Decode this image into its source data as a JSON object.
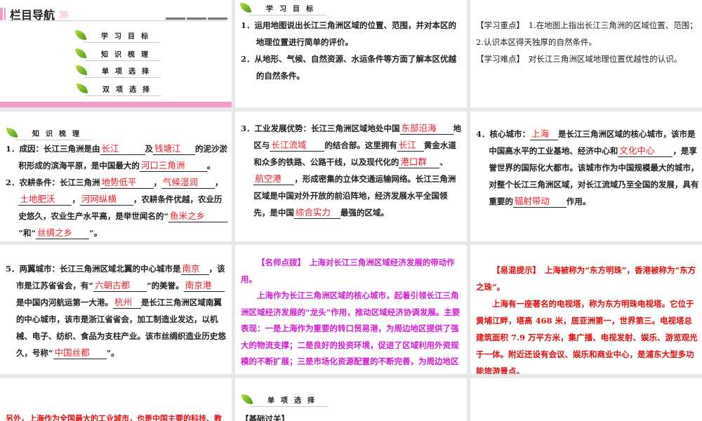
{
  "nav": {
    "title": "栏目导航",
    "arrows": "》》》",
    "items": [
      "学习目标",
      "知识梳理",
      "单项选择",
      "双项选择"
    ]
  },
  "objectives": {
    "heading": "学习目标",
    "items": [
      "1．运用地图说出长江三角洲区域的位置、范围，并对本区的地理位置进行简单的评价。",
      "2．从地形、气候、自然资源、水运条件等方面了解本区优越的自然条件。"
    ]
  },
  "key_points": {
    "focus": "【学习重点】　1.在地图上指出长江三角洲的区域位置、范围；2.认识本区得天独厚的自然条件。",
    "difficulty": "【学习难点】　对长江三角洲区域地理位置优越性的认识。"
  },
  "knowledge": {
    "heading": "知识梳理",
    "p1": [
      {
        "t": "1．成因：长江三角洲是由"
      },
      {
        "b": "长江",
        "w": 60
      },
      {
        "t": "及"
      },
      {
        "b": "钱塘江",
        "w": 56
      },
      {
        "t": "的泥沙淤积形成的滨海平原，是中国最大的"
      },
      {
        "b": "河口三角洲",
        "w": 92
      },
      {
        "t": "。"
      }
    ],
    "p2": [
      {
        "t": "2．农耕条件：长江三角洲"
      },
      {
        "b": "地势低平",
        "w": 72
      },
      {
        "t": "，"
      },
      {
        "b": "气候湿润",
        "w": 72
      },
      {
        "t": "，"
      },
      {
        "b": "土地肥沃",
        "w": 72
      },
      {
        "t": "，"
      },
      {
        "b": "河网纵横",
        "w": 72
      },
      {
        "t": "，农耕条件优越，农业历史悠久，农业生产水平高，是举世闻名的“"
      },
      {
        "b": "鱼米之乡",
        "w": 80
      },
      {
        "t": "”和“"
      },
      {
        "b": "丝绸之乡",
        "w": 72
      },
      {
        "t": "”。"
      }
    ],
    "p3": [
      {
        "t": "3．工业发展优势：长江三角洲区域地处中国"
      },
      {
        "b": "东部沿海",
        "w": 72
      },
      {
        "t": "地区与"
      },
      {
        "b": "长江流域",
        "w": 74
      },
      {
        "t": "的结合部。这里拥有"
      },
      {
        "b": "长江",
        "w": 34
      },
      {
        "t": "黄金水道和众多的铁路、公路干线，以及现代化的"
      },
      {
        "b": "港口群",
        "w": 54
      },
      {
        "t": "、"
      },
      {
        "b": "航空港",
        "w": 54
      },
      {
        "t": "，形成密集的立体交通运输网络。长江三角洲区域是中国对外开放的前沿阵地，经济发展水平全国领先，是中国"
      },
      {
        "b": "综合实力",
        "w": 62
      },
      {
        "t": "最强的区域。"
      }
    ],
    "p4": [
      {
        "t": "4．核心城市："
      },
      {
        "b": "上海",
        "w": 36
      },
      {
        "t": "是长江三角洲区域的核心城市，该市是中国高水平的工业基地、经济中心和"
      },
      {
        "b": "文化中心",
        "w": 74
      },
      {
        "t": "，是享誉世界的国际化大都市。该城市作为中国规模最大的城市，对整个长江三角洲区域，对长江流域乃至全国的发展，具有重要的"
      },
      {
        "b": "辐射带动",
        "w": 72
      },
      {
        "t": "作用。"
      }
    ],
    "p5": [
      {
        "t": "5．两翼城市：长江三角洲区域北翼的中心城市是"
      },
      {
        "b": "南京",
        "w": 36
      },
      {
        "t": "，该市是江苏省省会，有“"
      },
      {
        "b": "六朝古都",
        "w": 72
      },
      {
        "t": "”的美誉。"
      },
      {
        "b": "南京港",
        "w": 54
      },
      {
        "t": "是中国内河航运第一大港。"
      },
      {
        "b": "杭州",
        "w": 36
      },
      {
        "t": "是长江三角洲区域南翼的中心城市，该市是浙江省省会，加工制造业发达，以机械、电子、纺织、食品为支柱产业。该市丝绸织造业历史悠久，号称“"
      },
      {
        "b": "中国丝都",
        "w": 72
      },
      {
        "t": "”。"
      }
    ]
  },
  "teacher_tip": {
    "title": "【名师点拨】　上海对长江三角洲区域经济发展的带动作用。",
    "body": "上海作为长江三角洲区域的核心城市，起着引领长江三角洲区域经济发展的“龙头”作用，推动区域经济协调发展。主要表现：一是上海作为重要的转口贸易港，为周边地区提供了强大的物流支撑；二是良好的投资环境，促进了区域利用外资规模的不断扩展；三是市场化资源配置的不断完善，为周边地区经济的持续快速发展发挥了重要的带动作用。"
  },
  "confusion_tip": {
    "title": "【易混提示】　上海被称为“东方明珠”，香港被称为“东方之珠”。",
    "body": "上海有一座著名的电视塔，称为东方明珠电视塔。它位于黄埔江畔，塔高 468 米，居亚洲第一，世界第三。电视塔总建筑面积 7.9 万平方米，集广播、电视发射、娱乐、游览观光于一体。附近还设有会议、娱乐和商业中心，是浦东大型多功能旅游景点。"
  },
  "more": {
    "text": "另外，上海作为全国最大的工业城市，也是中国主要的科技、教"
  },
  "single_choice": {
    "heading": "单项选择",
    "sub": "【基础过关】"
  },
  "colors": {
    "pink": "#f59cc8",
    "answer_red": "#e8202a",
    "magenta": "#d020d0"
  }
}
